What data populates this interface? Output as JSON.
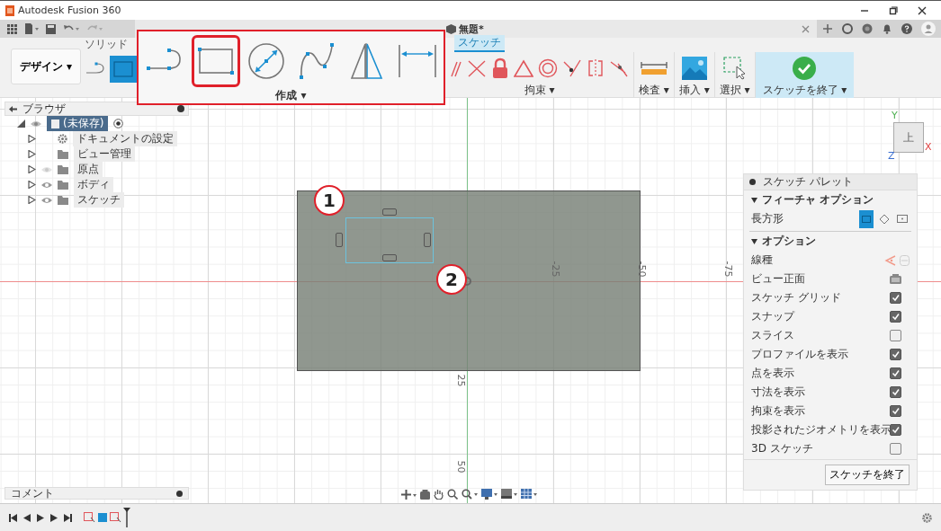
{
  "window": {
    "title": "Autodesk Fusion 360"
  },
  "document_tab": {
    "title": "無題*"
  },
  "ribbon": {
    "workspace": "デザイン ▾",
    "tabs": [
      {
        "label": "ソリッド",
        "selected": false
      },
      {
        "label": "スケッチ",
        "selected": true
      }
    ],
    "groups": [
      {
        "kind": "constraints",
        "label": "拘束 ▾"
      },
      {
        "kind": "inspect",
        "label": "検査 ▾"
      },
      {
        "kind": "insert",
        "label": "挿入 ▾"
      },
      {
        "kind": "select",
        "label": "選択 ▾"
      },
      {
        "kind": "finish",
        "label": "スケッチを終了 ▾"
      }
    ]
  },
  "create_callout": {
    "label": "作成 ▾",
    "tools": [
      {
        "kind": "arc",
        "selected": false
      },
      {
        "kind": "rectangle",
        "selected": true
      },
      {
        "kind": "circle",
        "selected": false
      },
      {
        "kind": "spline",
        "selected": false
      },
      {
        "kind": "mirror",
        "selected": false
      },
      {
        "kind": "dimension",
        "selected": false
      }
    ]
  },
  "browser": {
    "title": "ブラウザ",
    "root": {
      "label": "(未保存)",
      "expanded": true,
      "children": [
        {
          "kind": "settings",
          "label": "ドキュメントの設定",
          "expanded": false
        },
        {
          "kind": "folder",
          "label": "ビュー管理",
          "expanded": false
        },
        {
          "kind": "layer",
          "label": "原点",
          "expanded": false,
          "visible": false
        },
        {
          "kind": "layer",
          "label": "ボディ",
          "expanded": false,
          "visible": true
        },
        {
          "kind": "layer",
          "label": "スケッチ",
          "expanded": false,
          "visible": true
        }
      ]
    }
  },
  "comments": {
    "label": "コメント"
  },
  "canvas": {
    "x_ticks": [
      "-25",
      "-50",
      "-75"
    ],
    "y_ticks": [
      "25",
      "50"
    ],
    "markers": [
      "1",
      "2"
    ],
    "view_cube": {
      "face": "上",
      "axes": [
        "Y",
        "Z",
        "X"
      ]
    }
  },
  "palette": {
    "title": "スケッチ パレット",
    "feature_options": {
      "title": "フィーチャ オプション",
      "expanded": true,
      "label": "長方形",
      "types": [
        {
          "kind": "two-point",
          "selected": true
        },
        {
          "kind": "three-point",
          "selected": false
        },
        {
          "kind": "center",
          "selected": false
        }
      ]
    },
    "options": {
      "title": "オプション",
      "expanded": true,
      "rows": [
        {
          "kind": "linetype",
          "label": "線種"
        },
        {
          "kind": "button",
          "label": "ビュー正面"
        },
        {
          "kind": "checkbox",
          "label": "スケッチ グリッド",
          "checked": true
        },
        {
          "kind": "checkbox",
          "label": "スナップ",
          "checked": true
        },
        {
          "kind": "checkbox",
          "label": "スライス",
          "checked": false
        },
        {
          "kind": "checkbox",
          "label": "プロファイルを表示",
          "checked": true
        },
        {
          "kind": "checkbox",
          "label": "点を表示",
          "checked": true
        },
        {
          "kind": "checkbox",
          "label": "寸法を表示",
          "checked": true
        },
        {
          "kind": "checkbox",
          "label": "拘束を表示",
          "checked": true
        },
        {
          "kind": "checkbox",
          "label": "投影されたジオメトリを表示",
          "checked": true
        },
        {
          "kind": "checkbox",
          "label": "3D スケッチ",
          "checked": false
        }
      ]
    },
    "finish_button": "スケッチを終了"
  }
}
